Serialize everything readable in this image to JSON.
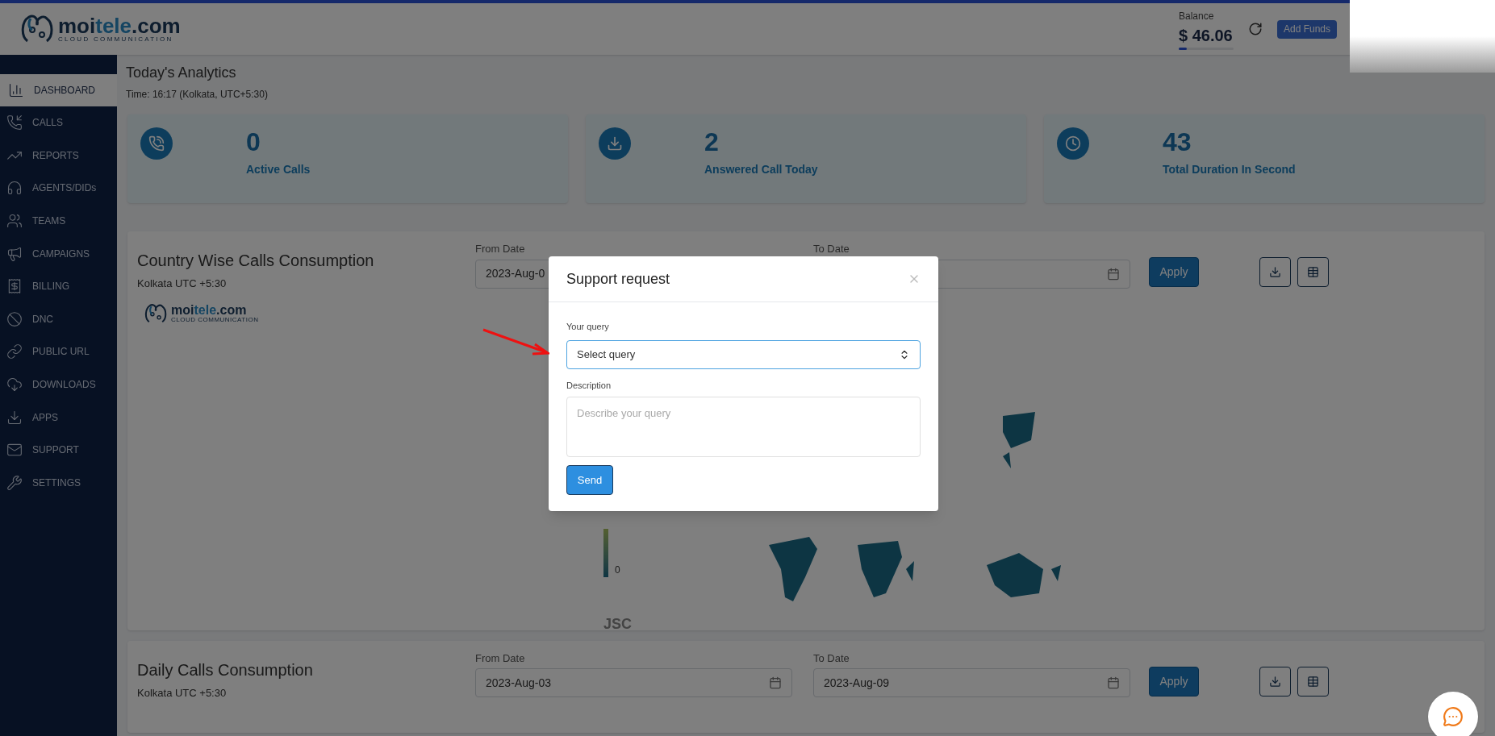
{
  "header": {
    "logo": {
      "prefix": "moi",
      "accent": "tele",
      "suffix": ".com",
      "tagline": "CLOUD COMMUNICATION"
    },
    "balance_label": "Balance",
    "balance": "$ 46.06",
    "add_funds": "Add Funds"
  },
  "sidebar": {
    "items": [
      {
        "label": "DASHBOARD",
        "selected": true
      },
      {
        "label": "CALLS",
        "selected": false
      },
      {
        "label": "REPORTS",
        "selected": false
      },
      {
        "label": "AGENTS/DIDs",
        "selected": false
      },
      {
        "label": "TEAMS",
        "selected": false
      },
      {
        "label": "CAMPAIGNS",
        "selected": false
      },
      {
        "label": "BILLING",
        "selected": false
      },
      {
        "label": "DNC",
        "selected": false
      },
      {
        "label": "PUBLIC URL",
        "selected": false
      },
      {
        "label": "DOWNLOADS",
        "selected": false
      },
      {
        "label": "APPS",
        "selected": false
      },
      {
        "label": "SUPPORT",
        "selected": false
      },
      {
        "label": "SETTINGS",
        "selected": false
      }
    ]
  },
  "analytics": {
    "title": "Today's Analytics",
    "time": "Time: 16:17 (Kolkata, UTC+5:30)",
    "cards": [
      {
        "value": "0",
        "label": "Active Calls"
      },
      {
        "value": "2",
        "label": "Answered Call Today"
      },
      {
        "value": "43",
        "label": "Total Duration In Second"
      }
    ]
  },
  "sections": [
    {
      "title": "Country Wise Calls Consumption",
      "subtitle": "Kolkata UTC +5:30",
      "from_label": "From Date",
      "from_value": "2023-Aug-0",
      "to_label": "To Date",
      "apply": "Apply",
      "map": {
        "logo": {
          "prefix": "moi",
          "accent": "tele",
          "suffix": ".com",
          "tagline": "CLOUD COMMUNICATION"
        },
        "legend_min": "0",
        "credit": "JSC"
      }
    },
    {
      "title": "Daily Calls Consumption",
      "subtitle": "Kolkata UTC +5:30",
      "from_label": "From Date",
      "from_value": "2023-Aug-03",
      "to_label": "To Date",
      "to_value": "2023-Aug-09",
      "apply": "Apply"
    }
  ],
  "modal": {
    "title": "Support request",
    "query_label": "Your query",
    "query_value": "Select query",
    "description_label": "Description",
    "description_placeholder": "Describe your query",
    "send": "Send"
  }
}
